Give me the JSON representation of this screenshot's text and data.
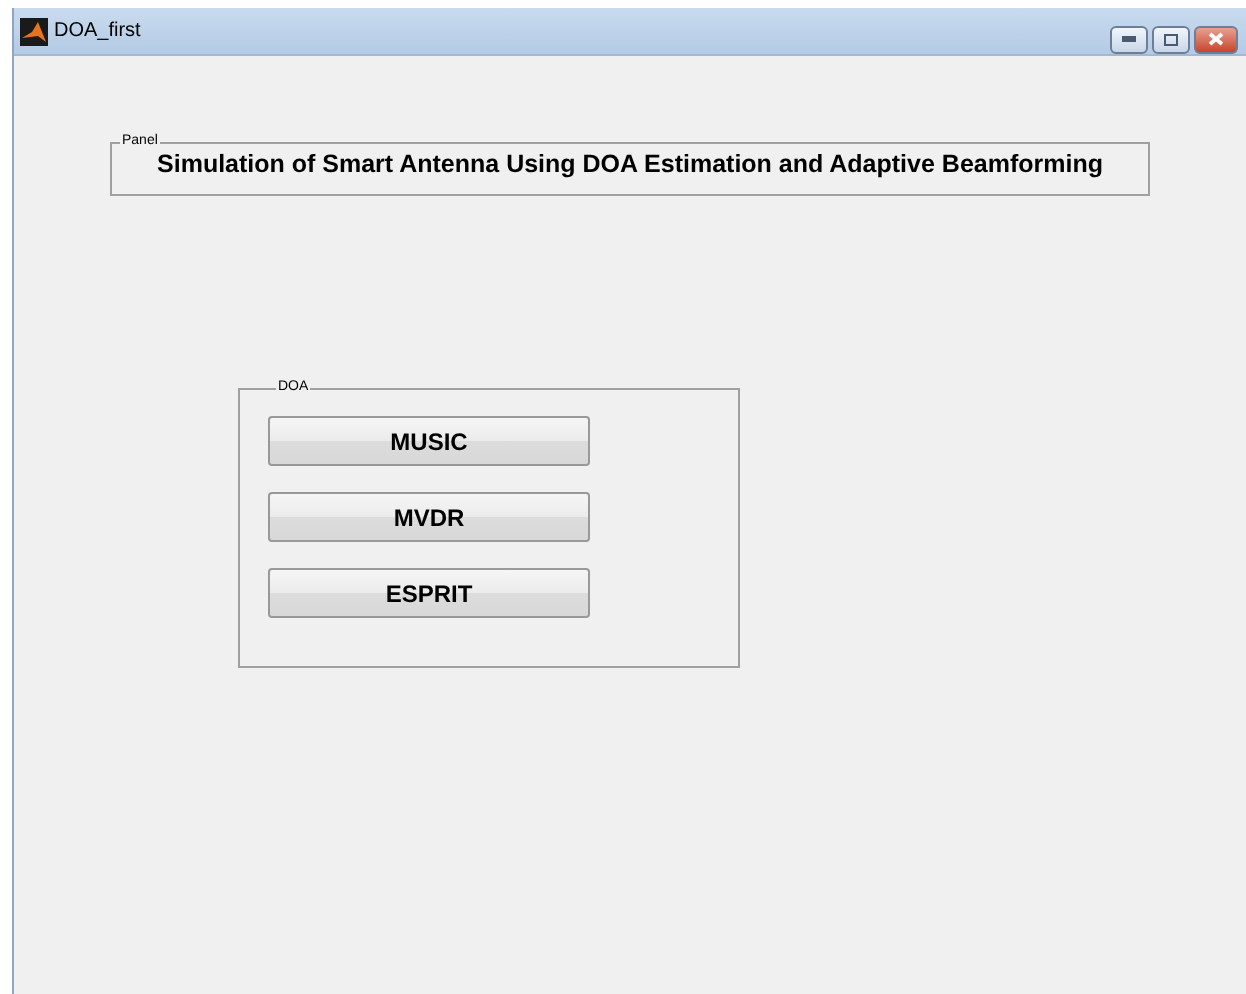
{
  "window": {
    "title": "DOA_first"
  },
  "title_panel": {
    "legend": "Panel",
    "heading": "Simulation of Smart Antenna Using DOA Estimation and Adaptive Beamforming"
  },
  "doa_panel": {
    "legend": "DOA",
    "buttons": [
      "MUSIC",
      "MVDR",
      "ESPRIT"
    ]
  }
}
